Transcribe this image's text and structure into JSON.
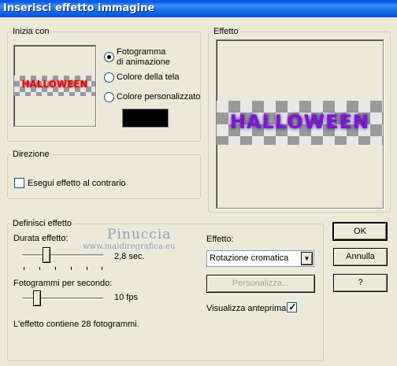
{
  "window": {
    "title": "Inserisci effetto immagine"
  },
  "start_group": {
    "legend": "Inizia con",
    "preview_text": "HALLOWEEN",
    "options": [
      {
        "label_line1": "Fotogramma",
        "label_line2": "di animazione",
        "checked": true
      },
      {
        "label": "Colore della tela",
        "checked": false
      },
      {
        "label": "Colore personalizzato",
        "checked": false
      }
    ],
    "custom_color": "#000000"
  },
  "effect_preview": {
    "legend": "Effetto",
    "preview_text": "HALLOWEEN",
    "text_color": "#7a18d0"
  },
  "direction_group": {
    "legend": "Direzione",
    "reverse_label": "Esegui effetto al contrario",
    "reverse_checked": false
  },
  "define_group": {
    "legend": "Definisci effetto",
    "duration_label": "Durata effetto:",
    "duration_value": "2,8 sec.",
    "duration_level": 0.3,
    "fps_label": "Fotogrammi per secondo:",
    "fps_value": "10 fps",
    "fps_level": 0.15,
    "frames_info": "L'effetto contiene 28 fotogrammi.",
    "effect_label": "Effetto:",
    "effect_selected": "Rotazione cromatica",
    "customize_label": "Personalizza...",
    "show_preview_label": "Visualizza anteprima",
    "show_preview_checked": true
  },
  "buttons": {
    "ok": "OK",
    "cancel": "Annulla",
    "help": "?"
  },
  "watermark": {
    "name": "Pinuccia",
    "site": "www.maidiregrafica.eu"
  }
}
